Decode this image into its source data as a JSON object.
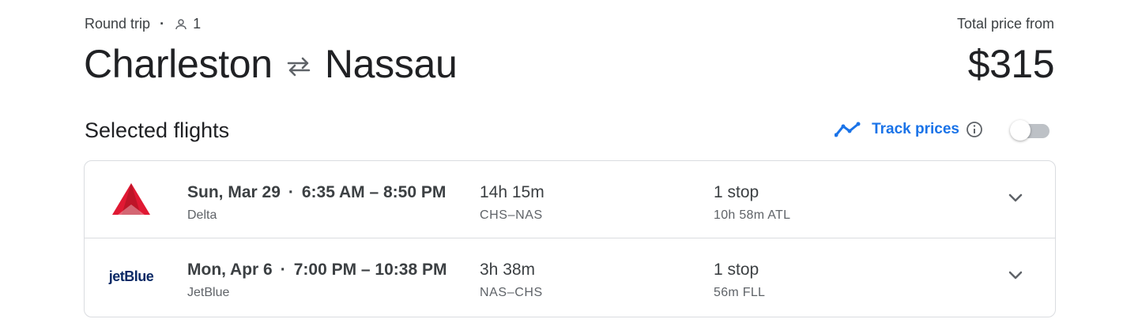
{
  "trip": {
    "type": "Round trip",
    "separator": "·",
    "passengers": "1",
    "origin": "Charleston",
    "destination": "Nassau",
    "price_label": "Total price from",
    "price": "$315"
  },
  "section": {
    "title": "Selected flights",
    "track_label": "Track prices",
    "track_enabled": false
  },
  "flights": [
    {
      "date": "Sun, Mar 29",
      "dot": "·",
      "times": "6:35 AM – 8:50 PM",
      "airline": "Delta",
      "duration": "14h 15m",
      "route": "CHS–NAS",
      "stops": "1 stop",
      "layover": "10h 58m ATL",
      "logo": "delta-logo"
    },
    {
      "date": "Mon, Apr 6",
      "dot": "·",
      "times": "7:00 PM – 10:38 PM",
      "airline": "JetBlue",
      "logo_text": "jetBlue",
      "duration": "3h 38m",
      "route": "NAS–CHS",
      "stops": "1 stop",
      "layover": "56m FLL",
      "logo": "jetblue-logo"
    }
  ],
  "colors": {
    "accent": "#1a73e8",
    "delta_red": "#e01933",
    "jetblue_navy": "#0b2a66",
    "border": "#dadce0"
  },
  "icons": [
    "person-icon",
    "swap-arrows-icon",
    "trend-line-icon",
    "info-icon",
    "chevron-down-icon"
  ]
}
